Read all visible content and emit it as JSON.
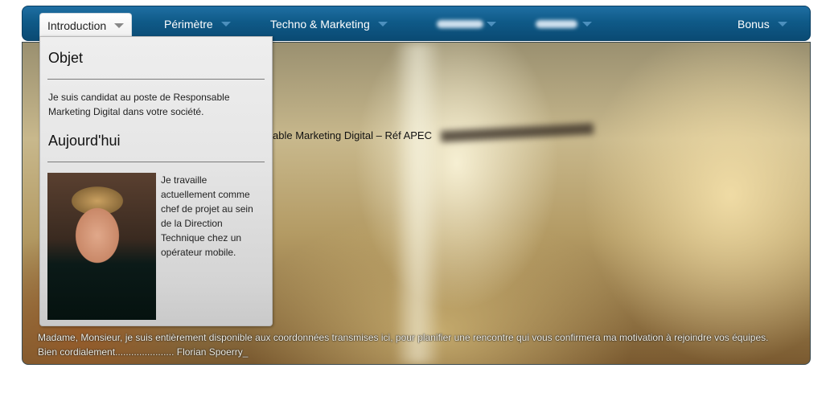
{
  "nav": {
    "items": [
      {
        "label": "Introduction",
        "active": true
      },
      {
        "label": "Périmètre"
      },
      {
        "label": "Techno & Marketing"
      },
      {
        "label": "Bonus"
      }
    ]
  },
  "dropdown": {
    "section1_title": "Objet",
    "section1_text": "Je suis candidat au poste de Responsable Marketing Digital dans votre société.",
    "section2_title": "Aujourd'hui",
    "section2_text": "Je travaille actuellement comme chef de projet au sein de la Direction Technique chez un opérateur mobile."
  },
  "main": {
    "headline": "able Marketing Digital – Réf APEC",
    "footer_line1": "Madame, Monsieur, je suis entièrement disponible aux coordonnées transmises ici, pour planifier une rencontre qui vous confirmera ma motivation à rejoindre vos équipes.",
    "footer_line2": "Bien cordialement...................... Florian Spoerry_"
  },
  "colors": {
    "nav_bg": "#0f5a88",
    "caret": "#4c8fbd"
  }
}
